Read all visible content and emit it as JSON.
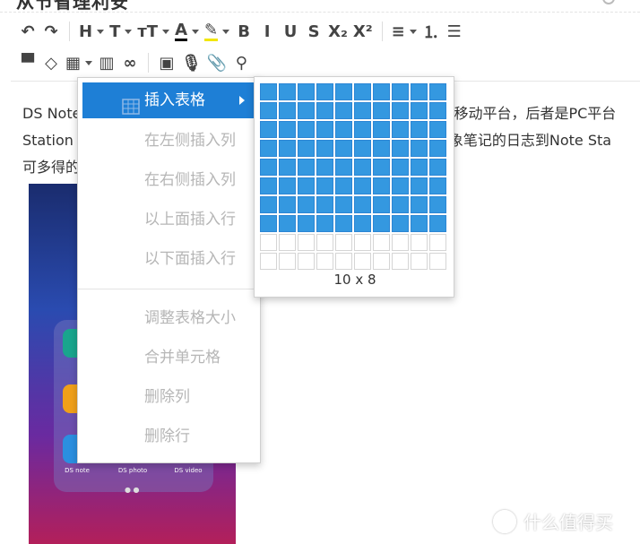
{
  "document": {
    "title": "从节省理利安",
    "lines": [
      {
        "left": "DS Note",
        "right": "是移动平台，后者是PC平台"
      },
      {
        "left": "Station",
        "right": "印象笔记的日志到Note Sta"
      },
      {
        "left": "可多得的",
        "right": ""
      }
    ]
  },
  "toolbar": {
    "row1": [
      {
        "name": "undo-icon",
        "glyph": "↶"
      },
      {
        "name": "redo-icon",
        "glyph": "↷"
      },
      {
        "name": "heading-icon",
        "glyph": "H",
        "caret": true
      },
      {
        "name": "font-family-icon",
        "glyph": "T",
        "caret": true
      },
      {
        "name": "font-size-icon",
        "glyph": "тT",
        "caret": true
      },
      {
        "name": "font-color-icon",
        "glyph": "A",
        "caret": true,
        "underline": "#000000"
      },
      {
        "name": "highlight-icon",
        "glyph": "✎",
        "caret": true,
        "underline": "#f2e600"
      },
      {
        "name": "bold-icon",
        "glyph": "B"
      },
      {
        "name": "italic-icon",
        "glyph": "I"
      },
      {
        "name": "underline-icon",
        "glyph": "U"
      },
      {
        "name": "strikethrough-icon",
        "glyph": "S"
      },
      {
        "name": "subscript-icon",
        "glyph": "X₂"
      },
      {
        "name": "superscript-icon",
        "glyph": "X²"
      },
      {
        "name": "align-icon",
        "glyph": "≡",
        "caret": true
      },
      {
        "name": "ordered-list-icon",
        "glyph": "⒈"
      },
      {
        "name": "bullet-list-icon",
        "glyph": "☰"
      }
    ],
    "row2": [
      {
        "name": "format-painter-icon",
        "glyph": "▀"
      },
      {
        "name": "eraser-icon",
        "glyph": "◇"
      },
      {
        "name": "table-icon",
        "glyph": "▦",
        "caret": true
      },
      {
        "name": "chart-icon",
        "glyph": "▥"
      },
      {
        "name": "link-icon",
        "glyph": "∞"
      },
      {
        "name": "image-icon",
        "glyph": "▣"
      },
      {
        "name": "microphone-icon",
        "glyph": "🎙"
      },
      {
        "name": "attachment-icon",
        "glyph": "📎"
      },
      {
        "name": "binoculars-icon",
        "glyph": "⚲"
      }
    ]
  },
  "table_menu": {
    "items": [
      {
        "label": "插入表格",
        "active": true
      },
      {
        "label": "在左侧插入列"
      },
      {
        "label": "在右侧插入列"
      },
      {
        "label": "以上面插入行"
      },
      {
        "label": "以下面插入行"
      },
      {
        "label": "调整表格大小"
      },
      {
        "label": "合并单元格"
      },
      {
        "label": "删除列"
      },
      {
        "label": "删除行"
      }
    ]
  },
  "grid_picker": {
    "columns": 10,
    "rows": 10,
    "selected_columns": 10,
    "selected_rows": 8,
    "size_label": "10 x 8",
    "highlight_color": "#3498e0"
  },
  "phone": {
    "apps": [
      "DS note",
      "DS photo",
      "DS video"
    ]
  },
  "watermark": {
    "text": "什么值得买"
  }
}
